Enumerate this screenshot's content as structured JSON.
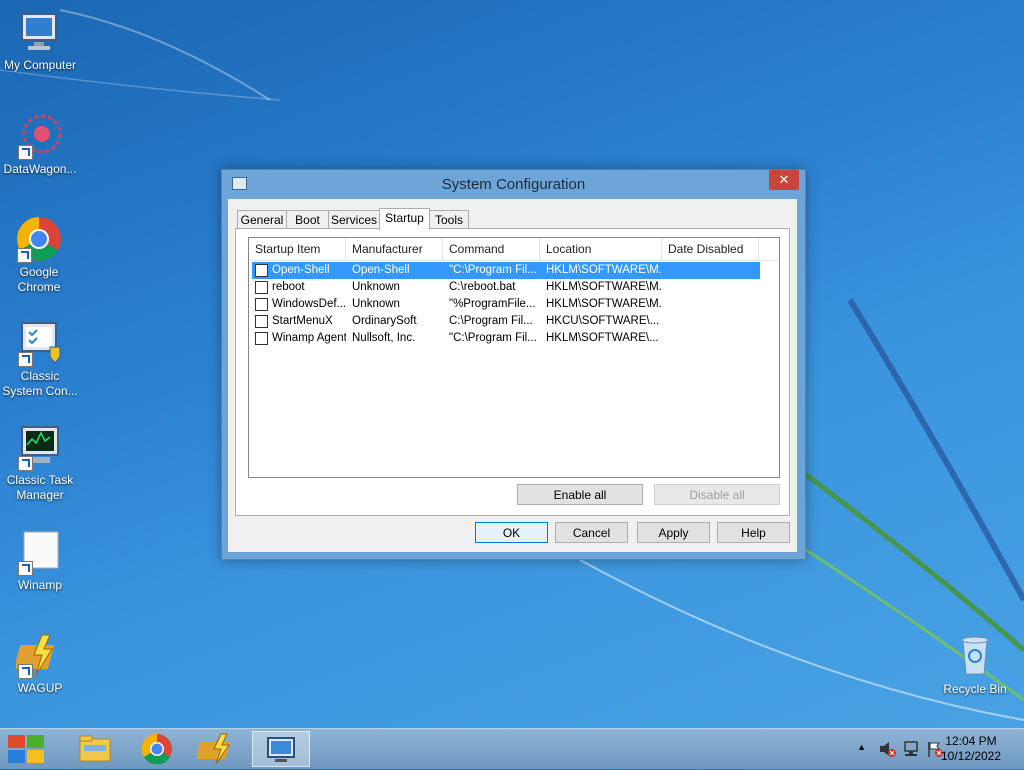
{
  "desktop": {
    "icons": [
      {
        "label": "My Computer"
      },
      {
        "label": "DataWagon..."
      },
      {
        "label": "Google Chrome"
      },
      {
        "label": "Classic System Con..."
      },
      {
        "label": "Classic Task Manager"
      },
      {
        "label": "Winamp"
      },
      {
        "label": "WAGUP"
      },
      {
        "label": "Recycle Bin"
      }
    ]
  },
  "window": {
    "title": "System Configuration",
    "close_glyph": "✕",
    "tabs": [
      {
        "label": "General"
      },
      {
        "label": "Boot"
      },
      {
        "label": "Services"
      },
      {
        "label": "Startup"
      },
      {
        "label": "Tools"
      }
    ],
    "columns": [
      "Startup Item",
      "Manufacturer",
      "Command",
      "Location",
      "Date Disabled"
    ],
    "rows": [
      {
        "item": "Open-Shell",
        "manufacturer": "Open-Shell",
        "command": "\"C:\\Program Fil...",
        "location": "HKLM\\SOFTWARE\\M...",
        "date": ""
      },
      {
        "item": "reboot",
        "manufacturer": "Unknown",
        "command": "C:\\reboot.bat",
        "location": "HKLM\\SOFTWARE\\M...",
        "date": ""
      },
      {
        "item": "WindowsDef...",
        "manufacturer": "Unknown",
        "command": "\"%ProgramFile...",
        "location": "HKLM\\SOFTWARE\\M...",
        "date": ""
      },
      {
        "item": "StartMenuX",
        "manufacturer": "OrdinarySoft",
        "command": "C:\\Program Fil...",
        "location": "HKCU\\SOFTWARE\\...",
        "date": ""
      },
      {
        "item": "Winamp Agent",
        "manufacturer": "Nullsoft, Inc.",
        "command": "\"C:\\Program Fil...",
        "location": "HKLM\\SOFTWARE\\...",
        "date": ""
      }
    ],
    "enable_all": "Enable all",
    "disable_all": "Disable all",
    "ok": "OK",
    "cancel": "Cancel",
    "apply": "Apply",
    "help": "Help"
  },
  "taskbar": {
    "time": "12:04 PM",
    "date": "10/12/2022",
    "tray_up_glyph": "▲"
  }
}
